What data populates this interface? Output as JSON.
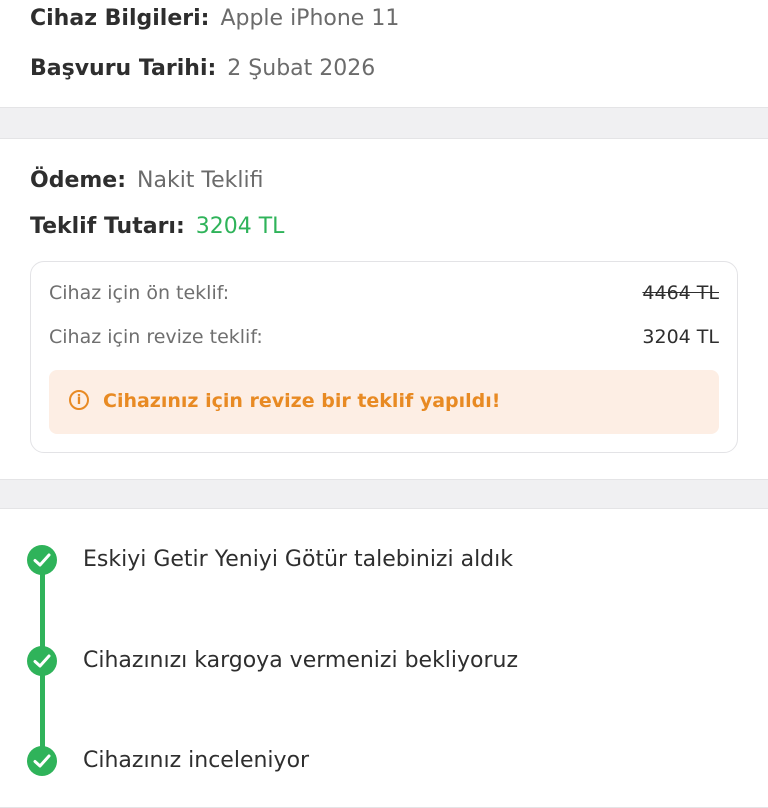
{
  "device_card": {
    "device_label": "Cihaz Bilgileri:",
    "device_value": "Apple iPhone 11",
    "date_label": "Başvuru Tarihi:",
    "date_value": "2 Şubat 2026"
  },
  "payment_card": {
    "payment_label": "Ödeme:",
    "payment_value": "Nakit Teklifi",
    "offer_label": "Teklif Tutarı:",
    "offer_value": "3204 TL",
    "pre_offer_label": "Cihaz için ön teklif:",
    "pre_offer_value": "4464 TL",
    "revised_offer_label": "Cihaz için revize teklif:",
    "revised_offer_value": "3204 TL",
    "alert_icon": "info-icon",
    "alert_message": "Cihazınız için revize bir teklif yapıldı!"
  },
  "status_card": {
    "steps": [
      {
        "label": "Eskiyi Getir Yeniyi Götür talebinizi aldık",
        "done": true
      },
      {
        "label": "Cihazınızı kargoya vermenizi bekliyoruz",
        "done": true
      },
      {
        "label": "Cihazınız inceleniyor",
        "done": true
      }
    ]
  },
  "colors": {
    "accent_green": "#2fb35a",
    "alert_orange": "#e88a23",
    "alert_background": "#fdeee4"
  }
}
